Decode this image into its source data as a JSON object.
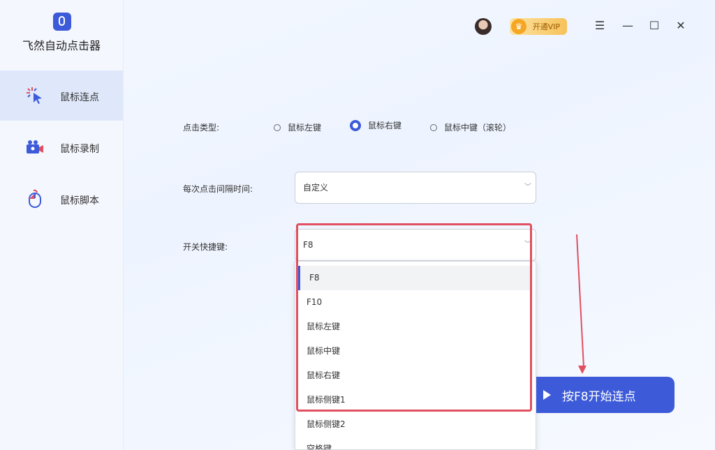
{
  "app": {
    "title": "飞然自动点击器"
  },
  "sidebar": {
    "items": [
      {
        "label": "鼠标连点",
        "icon": "cursor-click-icon",
        "active": true
      },
      {
        "label": "鼠标录制",
        "icon": "video-camera-icon",
        "active": false
      },
      {
        "label": "鼠标脚本",
        "icon": "mouse-icon",
        "active": false
      }
    ]
  },
  "topbar": {
    "vip_label": "开通VIP",
    "menu_icon": "menu-icon",
    "minimize_icon": "minimize-icon",
    "maximize_icon": "maximize-icon",
    "close_icon": "close-icon"
  },
  "form": {
    "click_type_label": "点击类型:",
    "click_type_options": [
      "鼠标左键",
      "鼠标右键",
      "鼠标中键（滚轮）"
    ],
    "click_type_selected": "鼠标右键",
    "interval_label": "每次点击间隔时间:",
    "interval_value": "自定义",
    "hotkey_label": "开关快捷键:",
    "hotkey_value": "F8",
    "hotkey_options": [
      "F8",
      "F10",
      "鼠标左键",
      "鼠标中键",
      "鼠标右键",
      "鼠标侧键1",
      "鼠标侧键2",
      "空格键"
    ]
  },
  "start_button": {
    "label": "按F8开始连点"
  },
  "colors": {
    "accent": "#3d5bd9",
    "highlight": "#e05060"
  }
}
